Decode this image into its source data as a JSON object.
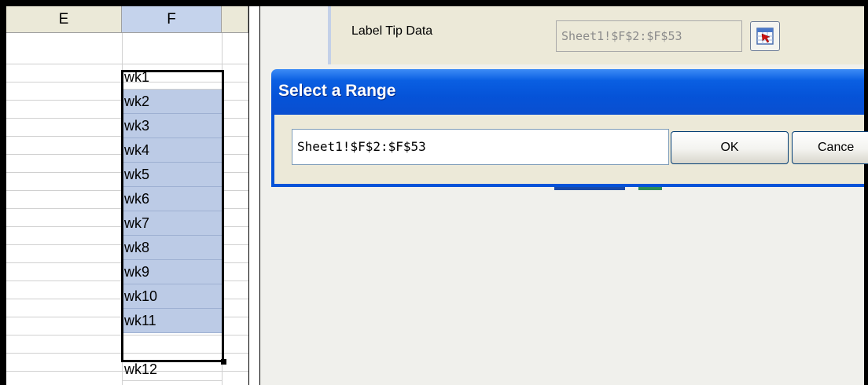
{
  "sheet": {
    "columns": [
      "E",
      "F"
    ],
    "column_f_values": [
      "wk1",
      "wk2",
      "wk3",
      "wk4",
      "wk5",
      "wk6",
      "wk7",
      "wk8",
      "wk9",
      "wk10",
      "wk11",
      "wk12"
    ],
    "selected_rows": "wk1-wk11"
  },
  "properties": {
    "label_tip_label": "Label Tip Data",
    "label_tip_value": "Sheet1!$F$2:$F$53",
    "picker_icon": "range-picker-icon"
  },
  "range_dialog": {
    "title": "Select a Range",
    "input_value": "Sheet1!$F$2:$F$53",
    "ok_label": "OK",
    "cancel_label": "Cance"
  },
  "colors": {
    "selection": "#bccbe6",
    "titlebar": "#0553d8",
    "header_bg": "#ebe9d8"
  }
}
